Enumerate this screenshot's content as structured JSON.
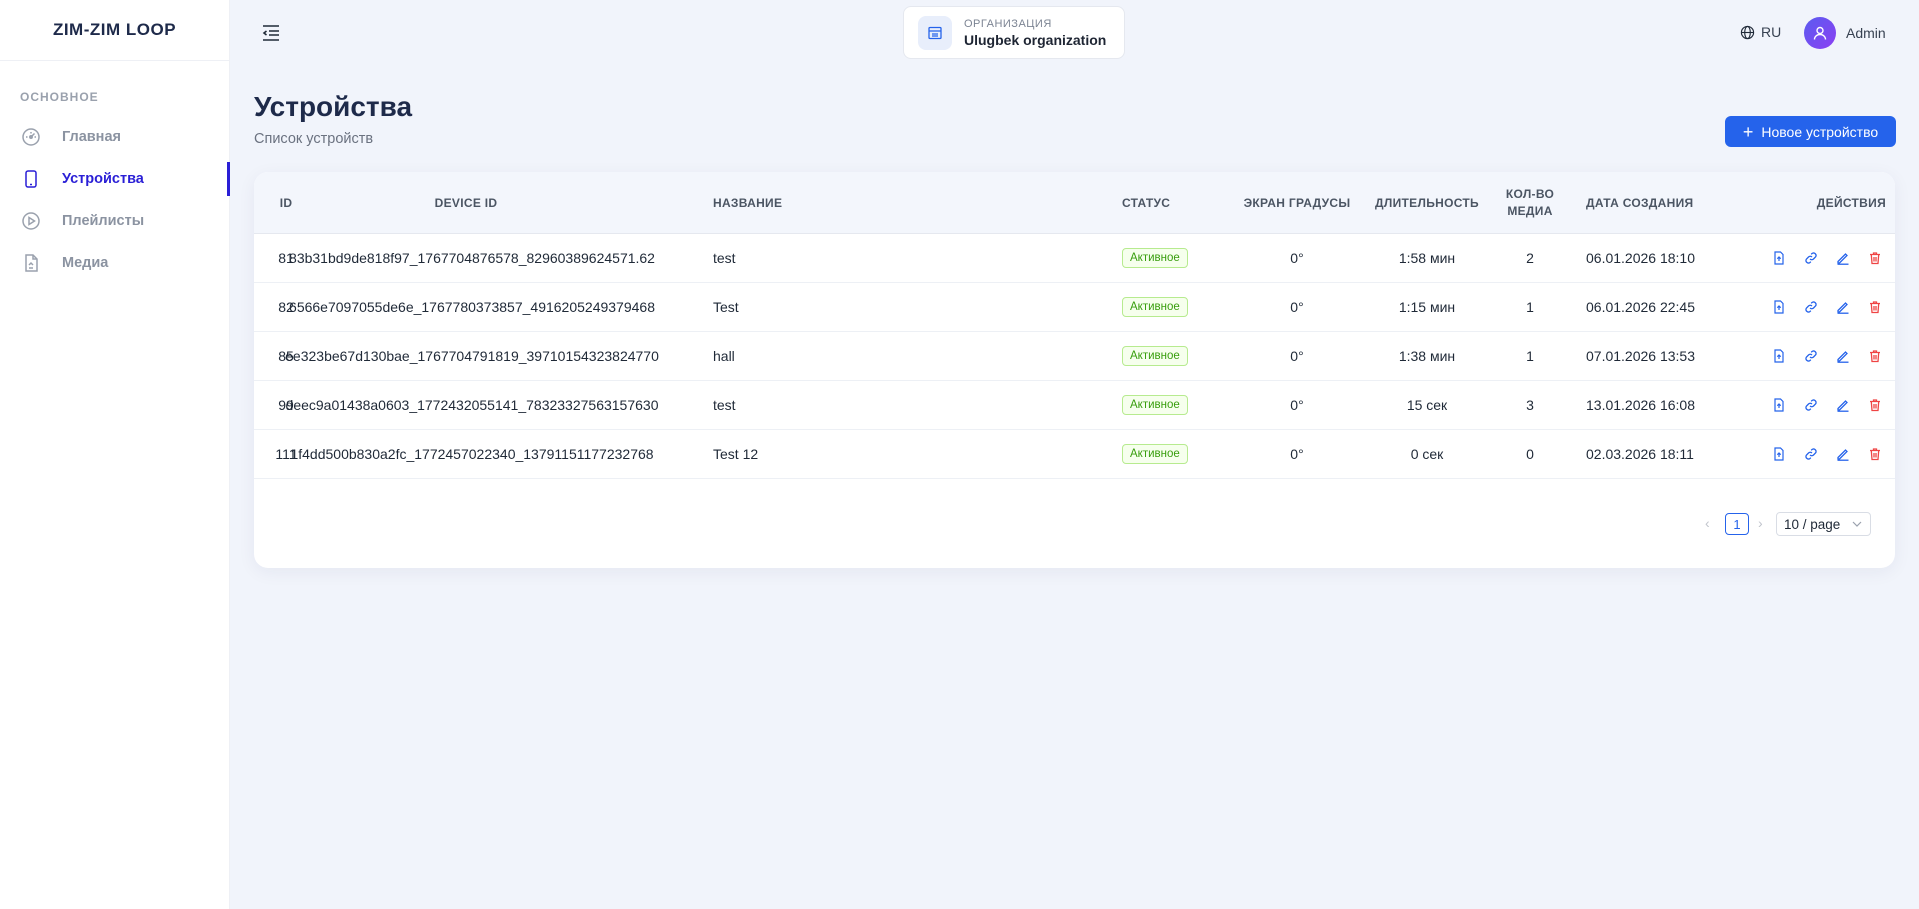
{
  "app": {
    "logo": "ZIM-ZIM LOOP"
  },
  "sidebar": {
    "section_title": "ОСНОВНОЕ",
    "items": [
      {
        "label": "Главная",
        "icon": "dashboard-icon",
        "active": false
      },
      {
        "label": "Устройства",
        "icon": "smartphone-icon",
        "active": true
      },
      {
        "label": "Плейлисты",
        "icon": "play-circle-icon",
        "active": false
      },
      {
        "label": "Медиа",
        "icon": "file-icon",
        "active": false
      }
    ]
  },
  "header": {
    "org_label": "ОРГАНИЗАЦИЯ",
    "org_name": "Ulugbek organization",
    "lang": "RU",
    "user_name": "Admin"
  },
  "page": {
    "title": "Устройства",
    "subtitle": "Список устройств",
    "new_button": "Новое устройство"
  },
  "table": {
    "columns": {
      "id": "ID",
      "device_id": "DEVICE ID",
      "name": "НАЗВАНИЕ",
      "status": "СТАТУС",
      "screen": "ЭКРАН ГРАДУСЫ",
      "duration": "ДЛИТЕЛЬНОСТЬ",
      "media_count": "КОЛ-ВО МЕДИА",
      "created": "ДАТА СОЗДАНИЯ",
      "actions": "ДЕЙСТВИЯ"
    },
    "rows": [
      {
        "id": "81",
        "device_id": "83b31bd9de818f97_1767704876578_82960389624571.62",
        "name": "test",
        "status": "Активное",
        "screen": "0°",
        "duration": "1:58 мин",
        "media_count": "2",
        "created": "06.01.2026 18:10"
      },
      {
        "id": "82",
        "device_id": "6566e7097055de6e_1767780373857_4916205249379468",
        "name": "Test",
        "status": "Активное",
        "screen": "0°",
        "duration": "1:15 мин",
        "media_count": "1",
        "created": "06.01.2026 22:45"
      },
      {
        "id": "85",
        "device_id": "ee323be67d130bae_1767704791819_39710154323824770",
        "name": "hall",
        "status": "Активное",
        "screen": "0°",
        "duration": "1:38 мин",
        "media_count": "1",
        "created": "07.01.2026 13:53"
      },
      {
        "id": "99",
        "device_id": "deec9a01438a0603_1772432055141_78323327563157630",
        "name": "test",
        "status": "Активное",
        "screen": "0°",
        "duration": "15 сек",
        "media_count": "3",
        "created": "13.01.2026 16:08"
      },
      {
        "id": "111",
        "device_id": "1f4dd500b830a2fc_1772457022340_13791151177232768",
        "name": "Test 12",
        "status": "Активное",
        "screen": "0°",
        "duration": "0 сек",
        "media_count": "0",
        "created": "02.03.2026 18:11"
      }
    ]
  },
  "pagination": {
    "current_page": "1",
    "page_size": "10 / page"
  },
  "colors": {
    "accent": "#2563eb",
    "active_nav": "#2a1fd6",
    "status_green": "#389e0d",
    "delete_red": "#ef4444"
  }
}
